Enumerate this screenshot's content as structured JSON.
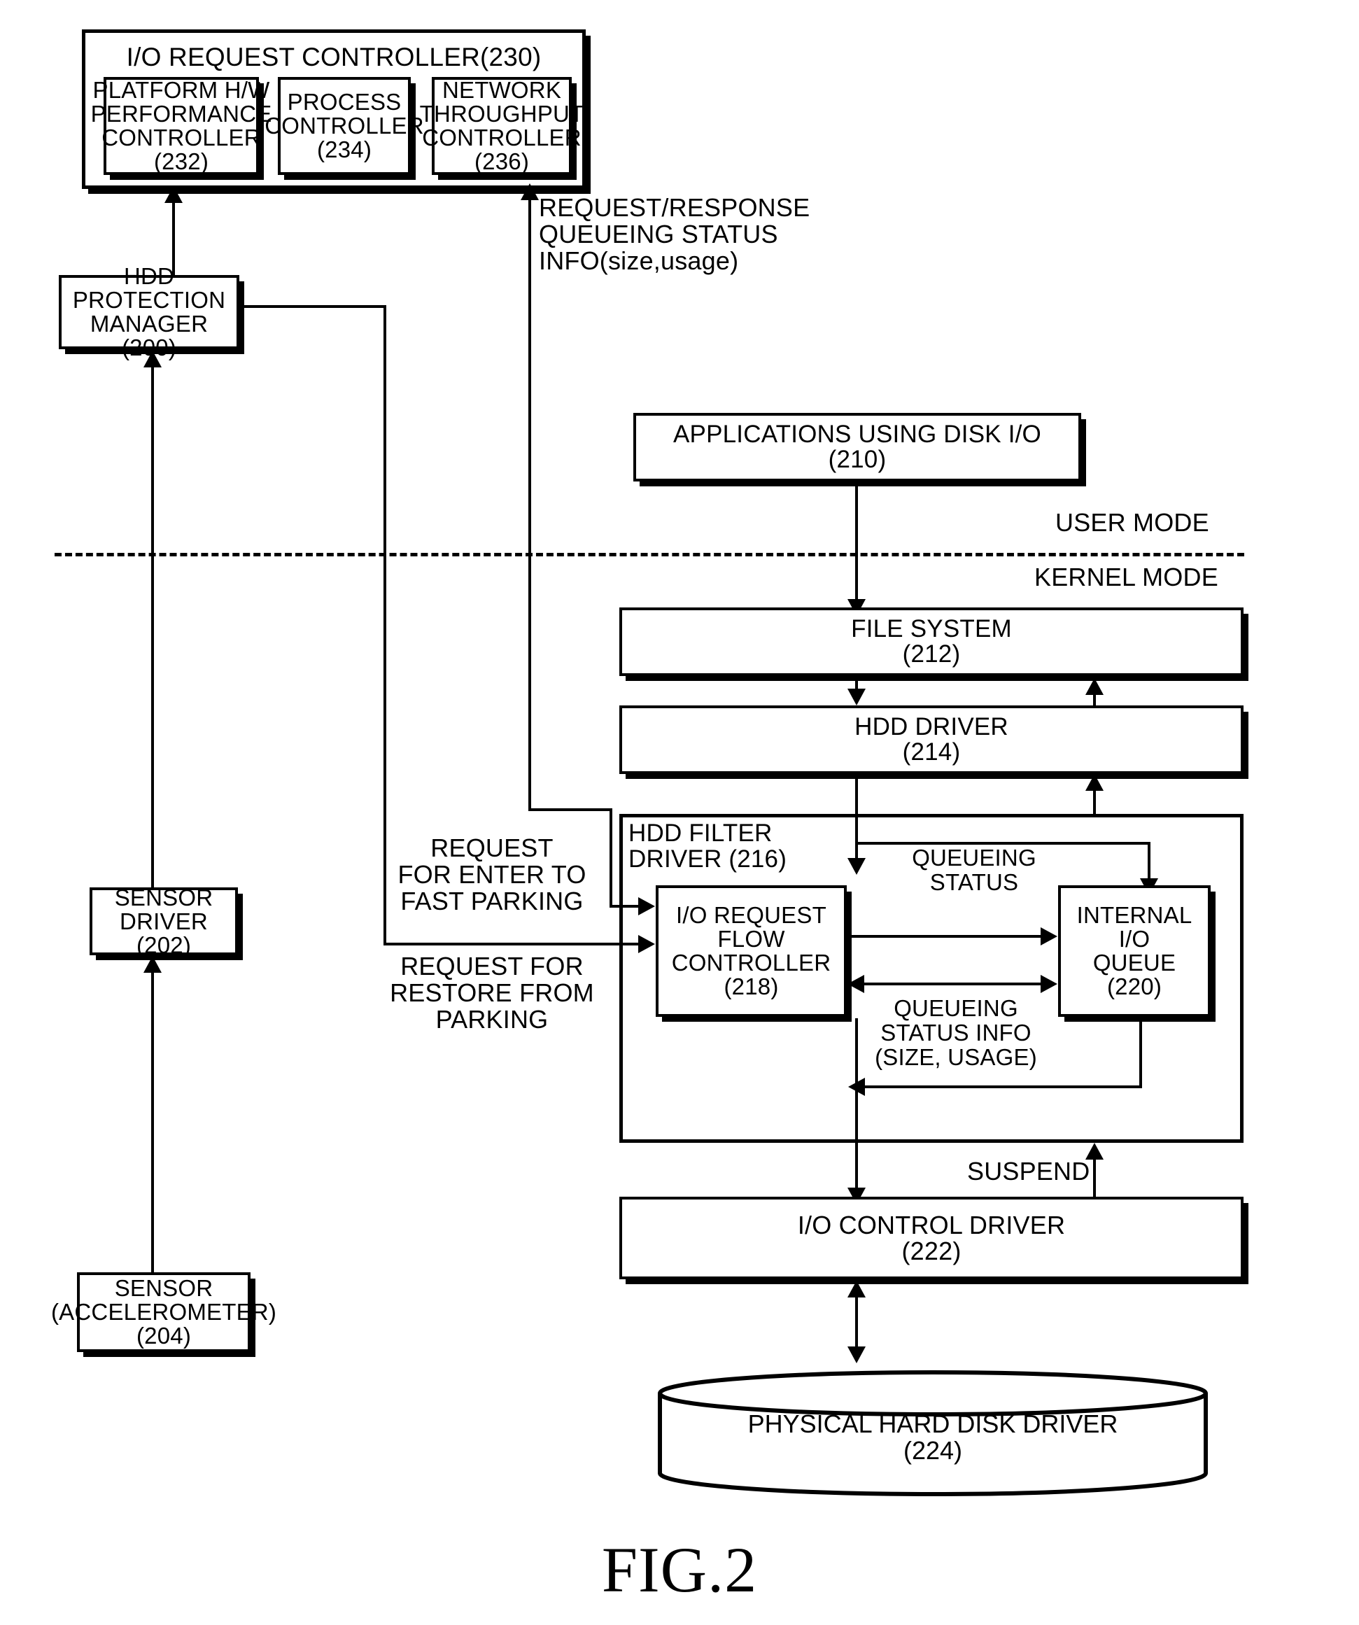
{
  "figure": {
    "caption": "FIG.2"
  },
  "mode_labels": {
    "user": "USER MODE",
    "kernel": "KERNEL MODE"
  },
  "io_request_controller": {
    "title": "I/O REQUEST CONTROLLER(230)",
    "children": [
      {
        "label": "PLATFORM H/W\nPERFORMANCE\nCONTROLLER\n(232)"
      },
      {
        "label": "PROCESS\nCONTROLLER\n(234)"
      },
      {
        "label": "NETWORK\nTHROUGHPUT\nCONTROLLER\n(236)"
      }
    ]
  },
  "blocks": {
    "hdd_protection_manager": "HDD PROTECTION\nMANAGER\n(200)",
    "sensor_driver": "SENSOR DRIVER\n(202)",
    "sensor": "SENSOR\n(ACCELEROMETER)\n(204)",
    "applications": "APPLICATIONS USING DISK I/O\n(210)",
    "file_system": "FILE SYSTEM\n(212)",
    "hdd_driver": "HDD DRIVER\n(214)",
    "hdd_filter_driver": "HDD FILTER\nDRIVER (216)",
    "io_request_flow_controller": "I/O REQUEST\nFLOW\nCONTROLLER\n(218)",
    "internal_io_queue": "INTERNAL\nI/O\nQUEUE\n(220)",
    "io_control_driver": "I/O CONTROL DRIVER\n(222)",
    "physical_hard_disk_driver": "PHYSICAL HARD DISK DRIVER\n(224)"
  },
  "edge_labels": {
    "request_response": "REQUEST/RESPONSE\nQUEUEING STATUS\nINFO(size,usage)",
    "enter_fast_parking": "REQUEST\nFOR ENTER TO\nFAST PARKING",
    "restore_from_parking": "REQUEST FOR\nRESTORE FROM\nPARKING",
    "queueing_status": "QUEUEING\nSTATUS",
    "queueing_status_info": "QUEUEING\nSTATUS INFO\n(SIZE, USAGE)",
    "suspend": "SUSPEND"
  }
}
